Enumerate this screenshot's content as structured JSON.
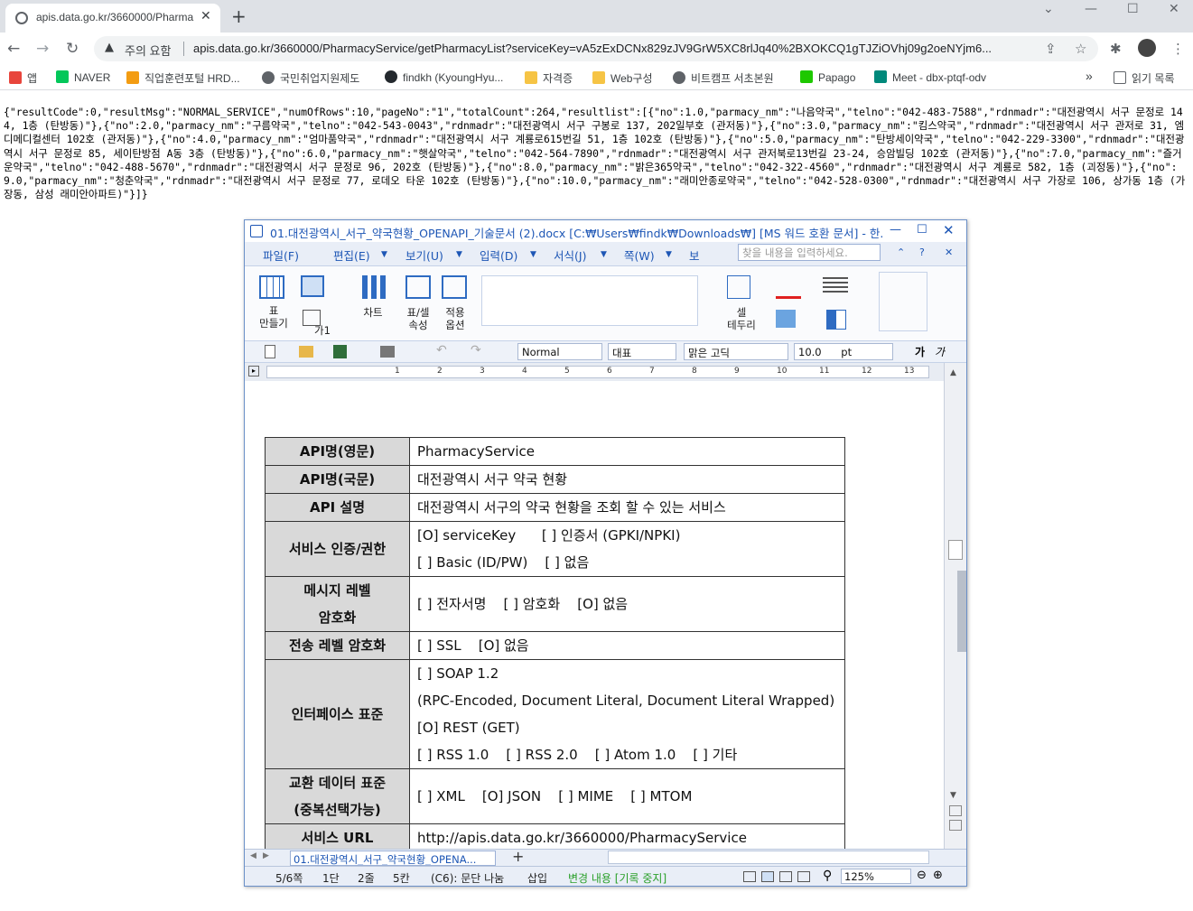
{
  "browser": {
    "tab_title": "apis.data.go.kr/3660000/Pharma",
    "tab_close": "✕",
    "new_tab": "+",
    "window_minimize": "⌄",
    "window_min": "—",
    "window_max": "☐",
    "window_close": "✕",
    "security_label": "주의 요함",
    "url": "apis.data.go.kr/3660000/PharmacyService/getPharmacyList?serviceKey=vA5zExDCNx829zJV9GrW5XC8rlJq40%2BXOKCQ1gTJZiOVhj09g2oeNYjm6...",
    "bookmarks": [
      {
        "label": "앱",
        "color": "#e8453c"
      },
      {
        "label": "NAVER",
        "color": "#03c75a"
      },
      {
        "label": "직업훈련포털 HRD...",
        "color": "#f39c12"
      },
      {
        "label": "국민취업지원제도",
        "color": "#5f6368"
      },
      {
        "label": "findkh (KyoungHyu...",
        "color": "#24292e"
      },
      {
        "label": "자격증",
        "color": "#f6c445"
      },
      {
        "label": "Web구성",
        "color": "#f6c445"
      },
      {
        "label": "비트캠프 서초본원",
        "color": "#5f6368"
      },
      {
        "label": "Papago",
        "color": "#1ec800"
      },
      {
        "label": "Meet - dbx-ptqf-odv",
        "color": "#00897b"
      }
    ],
    "bookmarks_more": "»",
    "reading_list": "읽기 목록"
  },
  "json_response": "{\"resultCode\":0,\"resultMsg\":\"NORMAL_SERVICE\",\"numOfRows\":10,\"pageNo\":\"1\",\"totalCount\":264,\"resultlist\":[{\"no\":1.0,\"parmacy_nm\":\"나음약국\",\"telno\":\"042-483-7588\",\"rdnmadr\":\"대전광역시 서구 문정로 144, 1층 (탄방동)\"},{\"no\":2.0,\"parmacy_nm\":\"구름약국\",\"telno\":\"042-543-0043\",\"rdnmadr\":\"대전광역시 서구 구봉로 137, 202일부호 (관저동)\"},{\"no\":3.0,\"parmacy_nm\":\"킴스약국\",\"rdnmadr\":\"대전광역시 서구 관저로 31, 엠디메디컬센터 102호 (관저동)\"},{\"no\":4.0,\"parmacy_nm\":\"엄마품약국\",\"rdnmadr\":\"대전광역시 서구 계룡로615번길 51, 1층 102호 (탄방동)\"},{\"no\":5.0,\"parmacy_nm\":\"탄방세이약국\",\"telno\":\"042-229-3300\",\"rdnmadr\":\"대전광역시 서구 문정로 85, 세이탄방점 A동 3층 (탄방동)\"},{\"no\":6.0,\"parmacy_nm\":\"햇살약국\",\"telno\":\"042-564-7890\",\"rdnmadr\":\"대전광역시 서구 관저북로13번길 23-24, 승암빌딩 102호 (관저동)\"},{\"no\":7.0,\"parmacy_nm\":\"즐거운약국\",\"telno\":\"042-488-5670\",\"rdnmadr\":\"대전광역시 서구 문정로 96, 202호 (탄방동)\"},{\"no\":8.0,\"parmacy_nm\":\"밝은365약국\",\"telno\":\"042-322-4560\",\"rdnmadr\":\"대전광역시 서구 계룡로 582, 1층 (괴정동)\"},{\"no\":9.0,\"parmacy_nm\":\"청춘약국\",\"rdnmadr\":\"대전광역시 서구 문정로 77, 로데오 타운 102호 (탄방동)\"},{\"no\":10.0,\"parmacy_nm\":\"래미안종로약국\",\"telno\":\"042-528-0300\",\"rdnmadr\":\"대전광역시 서구 가장로 106, 상가동 1층 (가장동, 삼성 래미안아파트)\"}]}",
  "word": {
    "title": "01.대전광역시_서구_약국현황_OPENAPI_기술문서 (2).docx [C:₩Users₩findk₩Downloads₩] [MS 워드 호환 문서] - 한...",
    "menu": [
      "파일(F)",
      "편집(E)",
      "보기(U)",
      "입력(D)",
      "서식(J)",
      "쪽(W)",
      "보"
    ],
    "search_placeholder": "찾을 내용을 입력하세요.",
    "ribbon": {
      "table_make": "표\n만들기",
      "border": "가1",
      "chart": "차트",
      "table_cell_prop": "표/셀\n속성",
      "apply_option": "적용\n옵션",
      "cell_border": "셀\n테두리"
    },
    "format": {
      "style": "Normal",
      "para": "대표",
      "font": "맑은 고딕",
      "size": "10.0",
      "unit": "pt"
    },
    "ruler_marks": [
      "1",
      "2",
      "3",
      "4",
      "5",
      "6",
      "7",
      "8",
      "9",
      "10",
      "11",
      "12",
      "13",
      "14"
    ],
    "table": [
      {
        "key": "API명(영문)",
        "lines": [
          "PharmacyService"
        ]
      },
      {
        "key": "API명(국문)",
        "lines": [
          "대전광역시 서구 약국 현황"
        ]
      },
      {
        "key": "API 설명",
        "lines": [
          "대전광역시 서구의 약국 현황을 조회 할 수 있는 서비스"
        ]
      },
      {
        "key": "서비스 인증/권한",
        "lines": [
          "[O] serviceKey      [ ] 인증서 (GPKI/NPKI)",
          "[ ] Basic (ID/PW)    [ ] 없음"
        ]
      },
      {
        "key": "메시지 레벨\n암호화",
        "lines": [
          "[ ] 전자서명    [ ] 암호화    [O] 없음"
        ]
      },
      {
        "key": "전송 레벨 암호화",
        "lines": [
          "[ ] SSL    [O] 없음"
        ]
      },
      {
        "key": "인터페이스 표준",
        "lines": [
          "[ ] SOAP 1.2",
          "(RPC-Encoded, Document Literal, Document Literal Wrapped)",
          "[O] REST (GET)",
          "[ ] RSS 1.0    [ ] RSS 2.0    [ ] Atom 1.0    [ ] 기타"
        ]
      },
      {
        "key": "교환 데이터 표준\n(중복선택가능)",
        "lines": [
          "[ ] XML    [O] JSON    [ ] MIME    [ ] MTOM"
        ]
      },
      {
        "key": "서비스 URL",
        "lines": [
          "http://apis.data.go.kr/3660000/PharmacyService"
        ]
      }
    ],
    "sheet_tab": "01.대전광역시_서구_약국현황_OPENA...",
    "status": {
      "page": "5/6쪽",
      "section": "1단",
      "line": "2줄",
      "col": "5칸",
      "cell": "(C6): 문단 나눔",
      "insert": "삽입",
      "track": "변경 내용 [기록 중지]",
      "zoom": "125%"
    }
  }
}
